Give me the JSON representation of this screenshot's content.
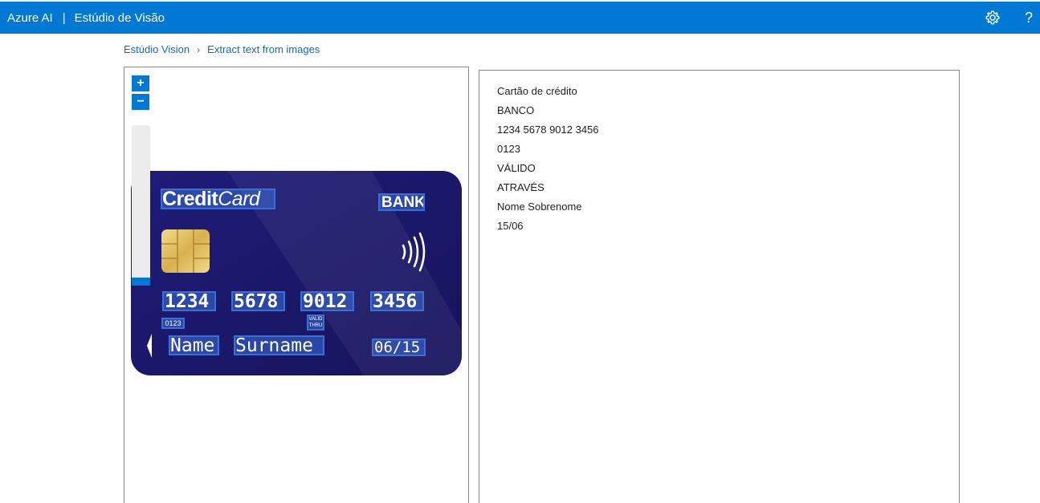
{
  "header": {
    "brand": "Azure AI",
    "separator": "|",
    "studio": "Estúdio de Visão",
    "settings_icon": "gear-icon",
    "help_label": "?"
  },
  "breadcrumb": {
    "root": "Estúdio Vision",
    "chevron": "›",
    "current": "Extract text from images"
  },
  "viewer": {
    "zoom_in": "+",
    "zoom_out": "−",
    "zoom_level": 0.05,
    "card": {
      "credit": "Credit",
      "card": "Card",
      "bank": "BANK",
      "numbers": [
        "1234",
        "5678",
        "9012",
        "3456"
      ],
      "small_code": "0123",
      "valid_line1": "VALID",
      "valid_line2": "THRU",
      "name": "Name",
      "surname": "Surname",
      "date": "06/15"
    }
  },
  "results": {
    "lines": [
      "Cartão de crédito",
      "BANCO",
      "1234 5678 9012 3456",
      "0123",
      "VÁLIDO",
      "ATRAVÉS",
      "Nome Sobrenome",
      "15/06"
    ]
  },
  "colors": {
    "accent": "#0078d4",
    "card_bg": "#1d1a6e",
    "ocr_highlight": "#3b6fd8"
  }
}
